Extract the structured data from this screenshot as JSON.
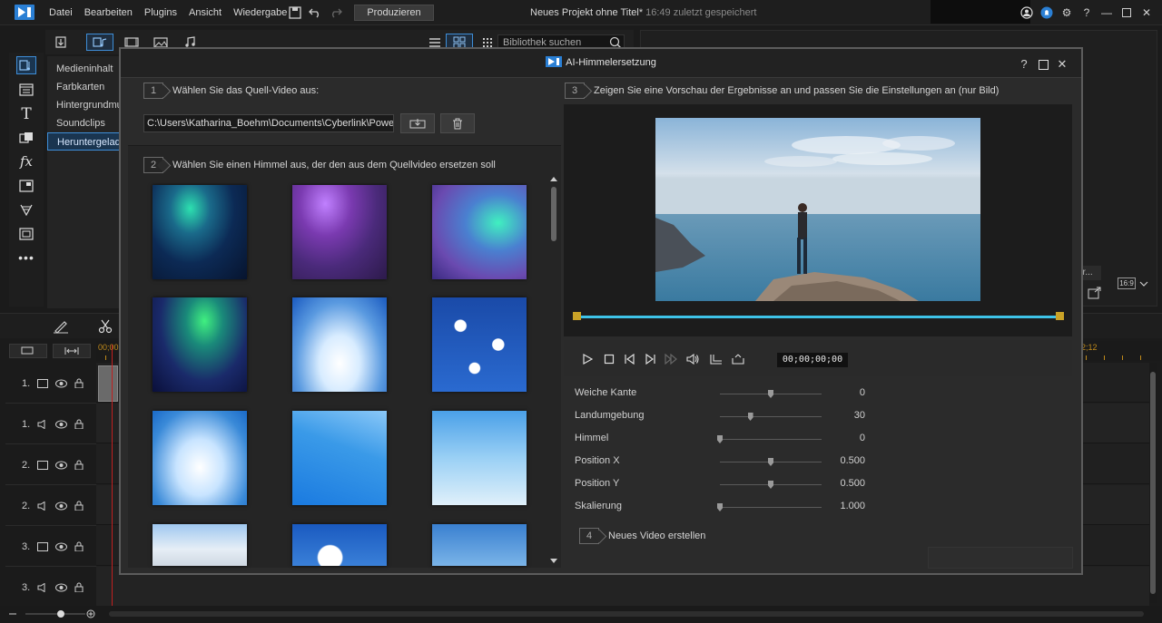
{
  "menu": [
    "Datei",
    "Bearbeiten",
    "Plugins",
    "Ansicht",
    "Wiedergabe"
  ],
  "produce_label": "Produzieren",
  "project": {
    "title": "Neues Projekt ohne Titel*",
    "saved": "16:49 zuletzt gespeichert"
  },
  "library": {
    "search_placeholder": "Bibliothek suchen",
    "items": [
      "Medieninhalt",
      "Farbkarten",
      "Hintergrundmu",
      "Soundclips",
      "Heruntergelade"
    ],
    "selected_index": 4
  },
  "dialog": {
    "title": "AI-Himmelersetzung",
    "step1": {
      "num": "1",
      "label": "Wählen Sie das Quell-Video aus:"
    },
    "source_path": "C:\\Users\\Katharina_Boehm\\Documents\\Cyberlink\\PowerDirect",
    "step2": {
      "num": "2",
      "label": "Wählen Sie einen Himmel aus, der den aus dem Quellvideo ersetzen soll"
    },
    "step3": {
      "num": "3",
      "label": "Zeigen Sie eine Vorschau der Ergebnisse an und passen Sie die Einstellungen an (nur Bild)"
    },
    "step4": {
      "num": "4",
      "label": "Neues Video erstellen"
    },
    "timecode": "00;00;00;00",
    "settings": [
      {
        "label": "Weiche Kante",
        "value": "0",
        "level": 0.5
      },
      {
        "label": "Landumgebung",
        "value": "30",
        "level": 0.3
      },
      {
        "label": "Himmel",
        "value": "0",
        "level": 0.0
      },
      {
        "label": "Position X",
        "value": "0.500",
        "level": 0.5
      },
      {
        "label": "Position Y",
        "value": "0.500",
        "level": 0.5
      },
      {
        "label": "Skalierung",
        "value": "1.000",
        "level": 0.0
      }
    ]
  },
  "right_panel": {
    "button_label": "or...",
    "aspect": "16:9"
  },
  "timeline": {
    "tracks": [
      {
        "num": "1.",
        "type": "video"
      },
      {
        "num": "1.",
        "type": "audio"
      },
      {
        "num": "2.",
        "type": "video"
      },
      {
        "num": "2.",
        "type": "audio"
      },
      {
        "num": "3.",
        "type": "video"
      },
      {
        "num": "3.",
        "type": "audio"
      }
    ],
    "ruler_start": "00;00",
    "ruler_end": "2;12"
  },
  "colors": {
    "accent": "#3e8ed8",
    "scrub": "#3ec3e8",
    "marker": "#c9a227",
    "playhead": "#c02020"
  }
}
